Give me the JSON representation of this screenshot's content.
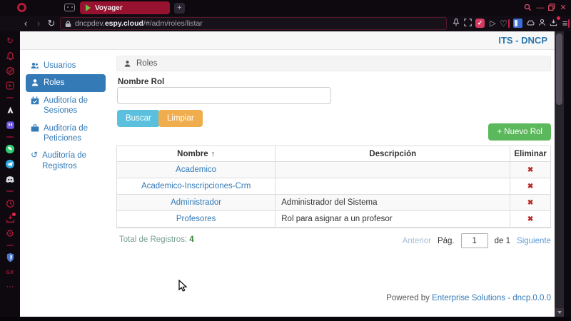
{
  "browser": {
    "tab_title": "Voyager",
    "url": {
      "subdomain": "dncpdev.",
      "host": "espy.cloud",
      "path": "/#/adm/roles/listar"
    }
  },
  "glyphs": {
    "back": "‹",
    "forward": "›",
    "reload": "↻",
    "new_tab": "+",
    "minimize": "—",
    "close": "✕",
    "menu": "≡",
    "heart": "♡",
    "play": "▷",
    "check": "✓",
    "dots": "⋯",
    "gear": "⚙",
    "history_clock": "↺",
    "gx": "GX",
    "sort_up": "↑",
    "delete_x": "✖",
    "plus": "+"
  },
  "app": {
    "brand": "ITS - DNCP",
    "sidebar": [
      {
        "label": "Usuarios"
      },
      {
        "label": "Roles"
      },
      {
        "label": "Auditoría de Sesiones"
      },
      {
        "label": "Auditoría de Peticiones"
      },
      {
        "label": "Auditoría de Registros"
      }
    ],
    "panel_title": "Roles",
    "form": {
      "label": "Nombre Rol",
      "value": "",
      "buscar": "Buscar",
      "limpiar": "Limpiar"
    },
    "new_role_label": "Nuevo Rol",
    "table": {
      "headers": {
        "nombre": "Nombre",
        "descripcion": "Descripción",
        "eliminar": "Eliminar"
      },
      "rows": [
        {
          "nombre": "Academico",
          "descripcion": ""
        },
        {
          "nombre": "Academico-Inscripciones-Crm",
          "descripcion": ""
        },
        {
          "nombre": "Administrador",
          "descripcion": "Administrador del Sistema"
        },
        {
          "nombre": "Profesores",
          "descripcion": "Rol para asignar a un profesor"
        }
      ]
    },
    "summary": {
      "label": "Total de Registros:",
      "count": "4"
    },
    "pagination": {
      "prev": "Anterior",
      "page_label": "Pág.",
      "page_value": "1",
      "of_label": "de 1",
      "next": "Siguiente"
    },
    "footer": {
      "prefix": "Powered by ",
      "link": "Enterprise Solutions - dncp.0.0.0"
    }
  },
  "colors": {
    "accent_blue": "#337ab7",
    "button_info": "#5bc0de",
    "button_warning": "#f0ad4e",
    "button_success": "#5cb85c",
    "delete_red": "#b52b27",
    "tab_crimson": "#96122f",
    "chrome_bg": "#0d090f",
    "brand_text": "#2a76ae"
  }
}
